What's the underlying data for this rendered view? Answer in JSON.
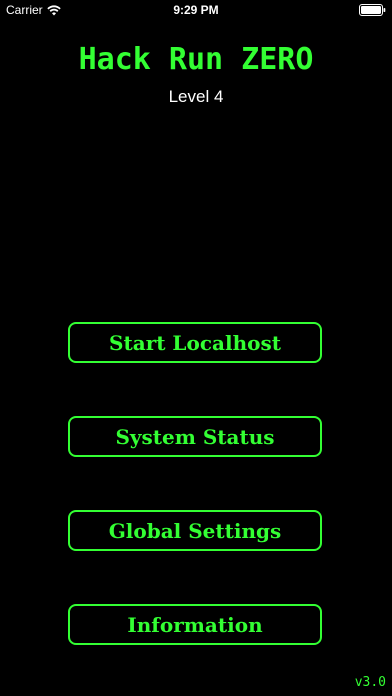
{
  "status_bar": {
    "carrier": "Carrier",
    "time": "9:29 PM",
    "wifi_icon": "wifi-icon",
    "battery_icon": "battery-icon"
  },
  "app": {
    "title": "Hack Run ZERO",
    "level": "Level 4",
    "accent_color": "#33ff33",
    "background_color": "#000000"
  },
  "menu": {
    "start_localhost": "Start Localhost",
    "system_status": "System Status",
    "global_settings": "Global Settings",
    "information": "Information"
  },
  "footer": {
    "version": "v3.0"
  }
}
